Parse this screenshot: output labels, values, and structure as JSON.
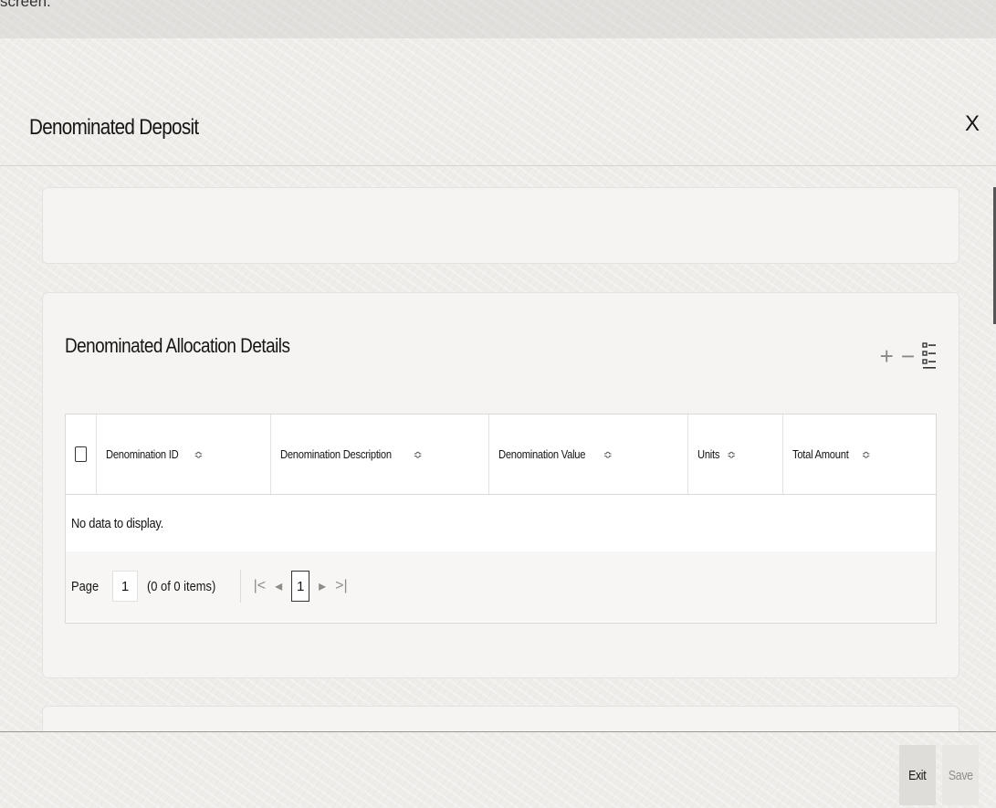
{
  "caption": "screen.",
  "header": {
    "title": "Denominated Deposit",
    "close_label": "X"
  },
  "allocation": {
    "title": "Denominated Allocation Details",
    "toolbar": {
      "add_label": "+",
      "remove_label": "−"
    },
    "columns": [
      "Denomination ID",
      "Denomination Description",
      "Denomination Value",
      "Units",
      "Total Amount"
    ],
    "sort_glyph": "≎",
    "empty_message": "No data to display.",
    "pager": {
      "page_label": "Page",
      "page_value": "1",
      "items_text": "(0 of 0 items)",
      "first_glyph": "|<",
      "prev_glyph": "◂",
      "current_page": "1",
      "next_glyph": "▸",
      "last_glyph": ">|"
    }
  },
  "footer": {
    "exit_label": "Exit",
    "save_label": "Save"
  }
}
